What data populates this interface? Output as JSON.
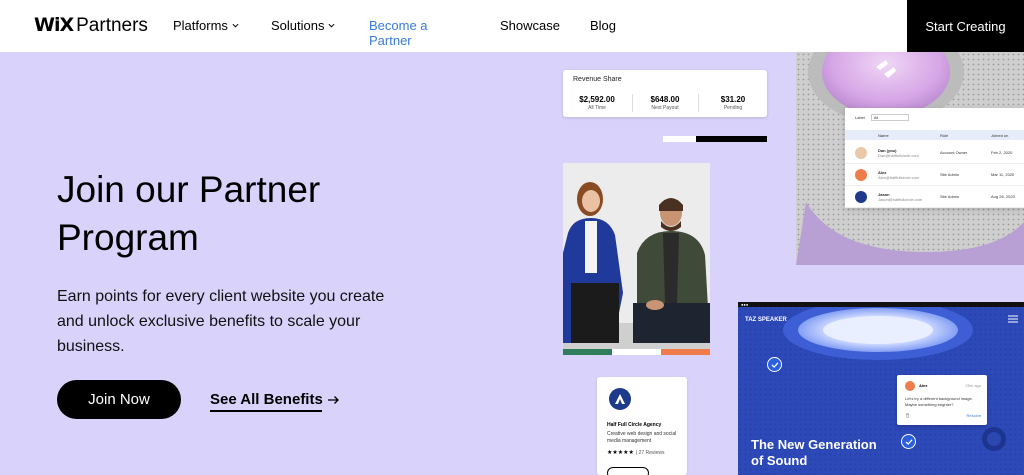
{
  "header": {
    "logo_wix": "WiX",
    "logo_partners": "Partners",
    "nav": [
      {
        "label": "Platforms"
      },
      {
        "label": "Solutions"
      },
      {
        "label": "Become a Partner"
      },
      {
        "label": "Showcase"
      },
      {
        "label": "Blog"
      }
    ],
    "cta": "Start Creating"
  },
  "hero": {
    "title": "Join our Partner Program",
    "subtitle": "Earn points for every client website you create and unlock exclusive benefits to scale your business.",
    "primary_button": "Join Now",
    "secondary_link": "See All Benefits"
  },
  "revenue_card": {
    "title": "Revenue Share",
    "stats": [
      {
        "value": "$2,592.00",
        "label": "All Time"
      },
      {
        "value": "$648.00",
        "label": "Next Payout"
      },
      {
        "value": "$31.20",
        "label": "Pending"
      }
    ]
  },
  "team_table": {
    "filter_label": "Label",
    "filter_value": "All",
    "columns": [
      "Name",
      "Role",
      "Joined on"
    ],
    "rows": [
      {
        "name": "Dan (you)",
        "email": "Dan@halffullcircle.com",
        "role": "Account Owner",
        "joined": "Feb 2, 2020",
        "avatar_color": "#e9c9a8"
      },
      {
        "name": "Alex",
        "email": "Alex@halffullcircle.com",
        "role": "Site Admin",
        "joined": "Mar 11, 2020",
        "avatar_color": "#ef7d4c"
      },
      {
        "name": "Jason",
        "email": "Jason@halffullcircle.com",
        "role": "Site Admin",
        "joined": "Aug 26, 2020",
        "avatar_color": "#1e3a8a"
      }
    ]
  },
  "agency_card": {
    "logo_letter": "A",
    "name": "Half Full Circle Agency",
    "description": "Creative web design and social media management",
    "stars": "★★★★★",
    "reviews": "| 27 Reviews"
  },
  "site_preview": {
    "brand": "TAZ SPEAKER",
    "headline": "The New Generation of Sound",
    "chat": {
      "name": "Alex",
      "time": "25m ago",
      "message": "Let's try a different background image. Maybe something brighter?",
      "action": "Resolve"
    }
  },
  "colors": {
    "background": "#d9d3fb",
    "accent_link": "#3b7cd9",
    "strip": [
      "#2e7d5b",
      "#ffffff",
      "#ef7d4c"
    ]
  }
}
